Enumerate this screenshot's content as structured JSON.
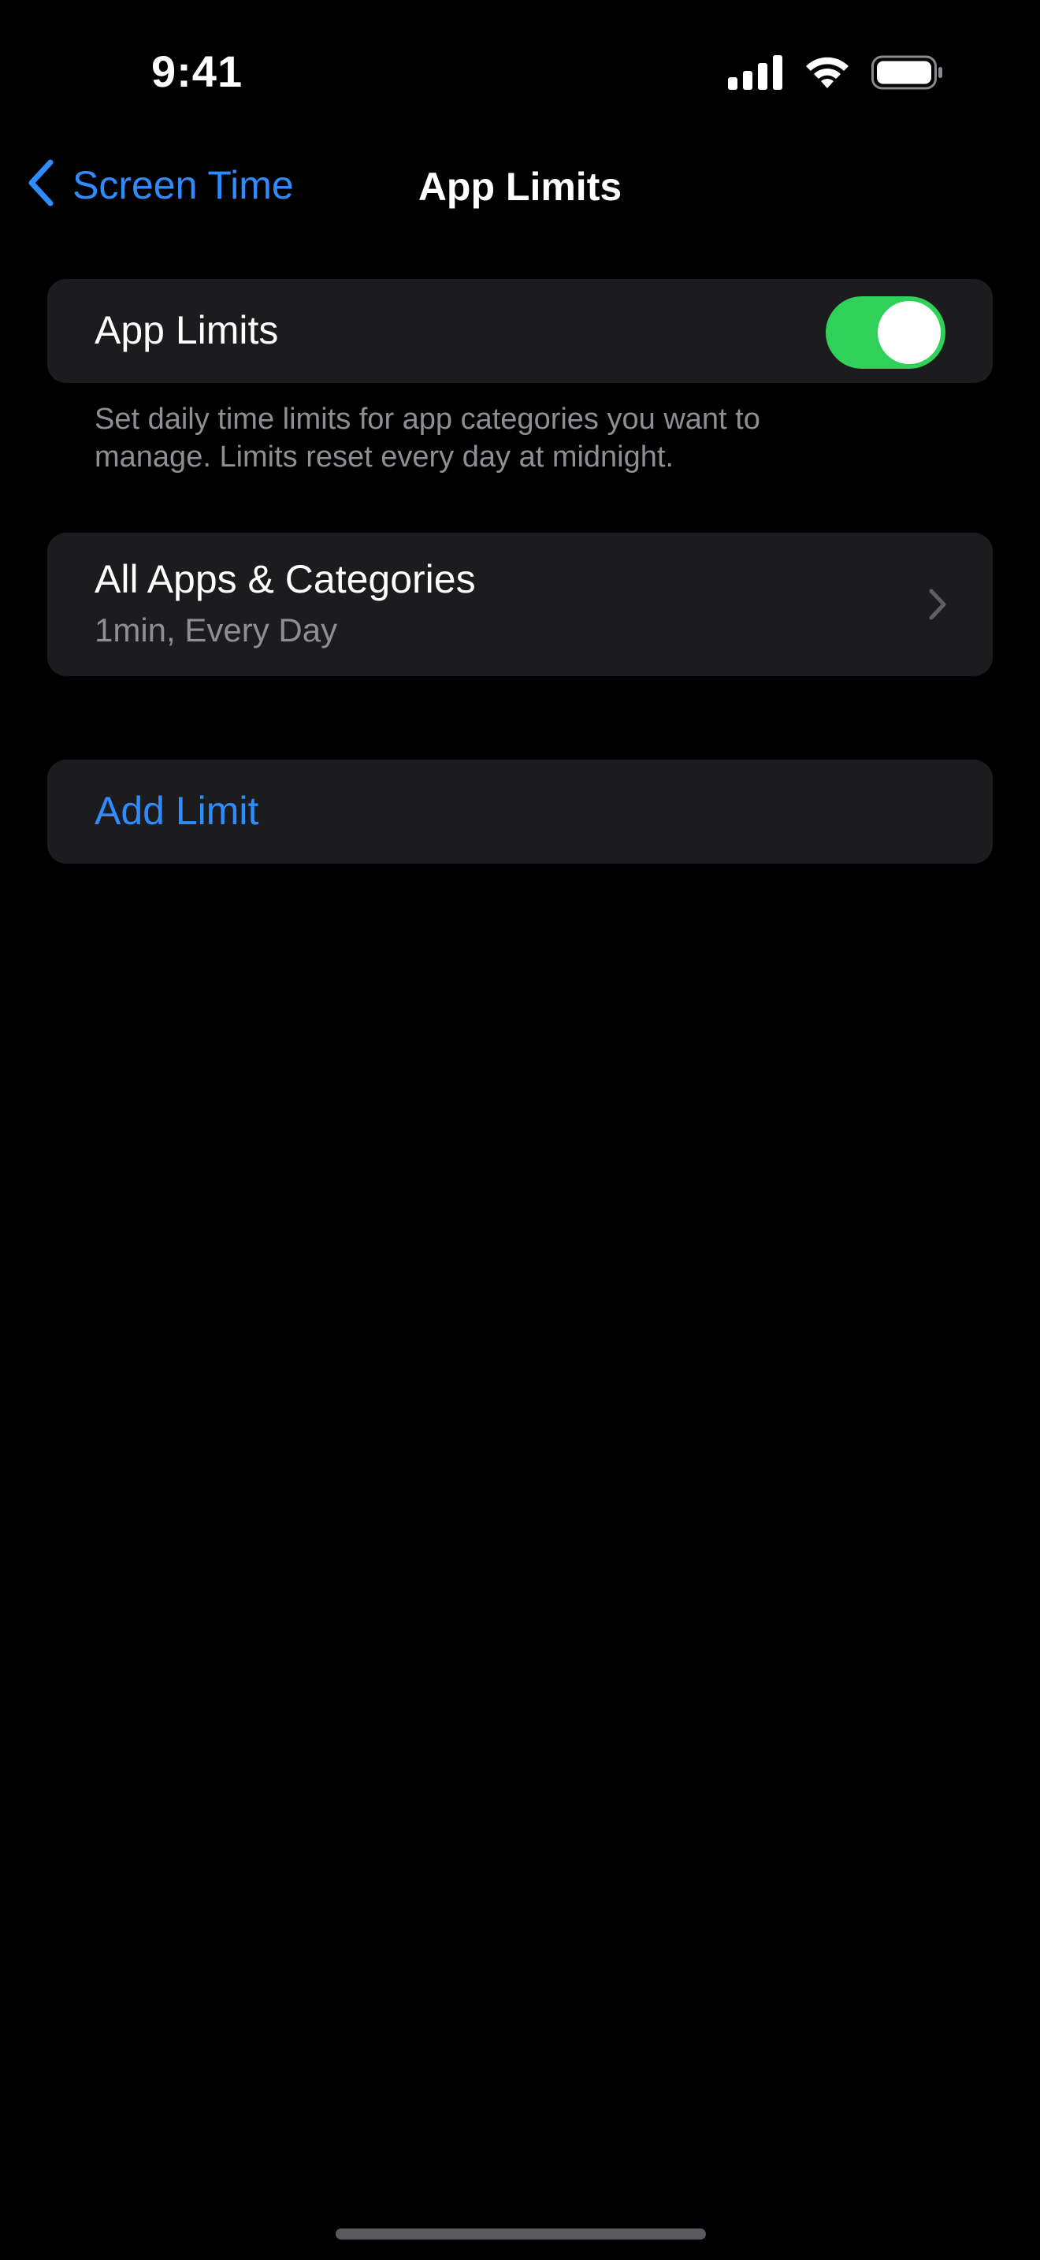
{
  "status_bar": {
    "time": "9:41",
    "icons": [
      "signal-icon",
      "wifi-icon",
      "battery-icon"
    ]
  },
  "nav": {
    "back_label": "Screen Time",
    "title": "App Limits"
  },
  "toggle_section": {
    "label": "App Limits",
    "enabled": true,
    "footer": "Set daily time limits for app categories you want to manage. Limits reset every day at midnight."
  },
  "limits": [
    {
      "title": "All Apps & Categories",
      "subtitle": "1min, Every Day"
    }
  ],
  "add_limit_label": "Add Limit",
  "colors": {
    "background": "#000000",
    "cell": "#1c1c1e",
    "accent": "#2f8cff",
    "toggle_on": "#30d158",
    "secondary_text": "#8e8e93"
  }
}
